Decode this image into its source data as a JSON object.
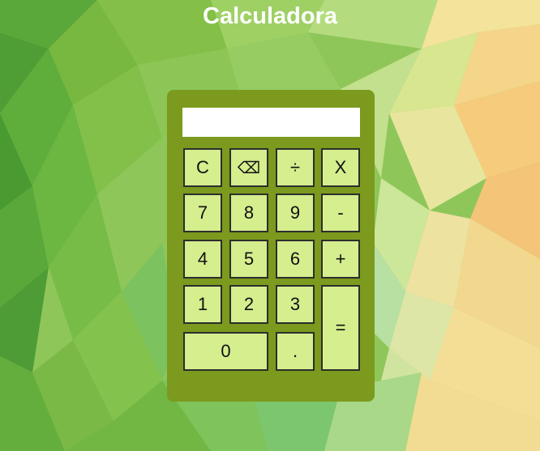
{
  "page": {
    "title": "Calculadora"
  },
  "display": {
    "value": ""
  },
  "keys": {
    "clear": "C",
    "backspace": "⌫",
    "divide": "÷",
    "multiply": "X",
    "seven": "7",
    "eight": "8",
    "nine": "9",
    "subtract": "-",
    "four": "4",
    "five": "5",
    "six": "6",
    "add": "+",
    "one": "1",
    "two": "2",
    "three": "3",
    "equals": "=",
    "zero": "0",
    "decimal": "."
  },
  "colors": {
    "calculator_body": "#7b9a1e",
    "key_fill": "#d5ee8e",
    "key_border": "#2d2d2d",
    "display_fill": "#ffffff",
    "title_text": "#ffffff"
  }
}
